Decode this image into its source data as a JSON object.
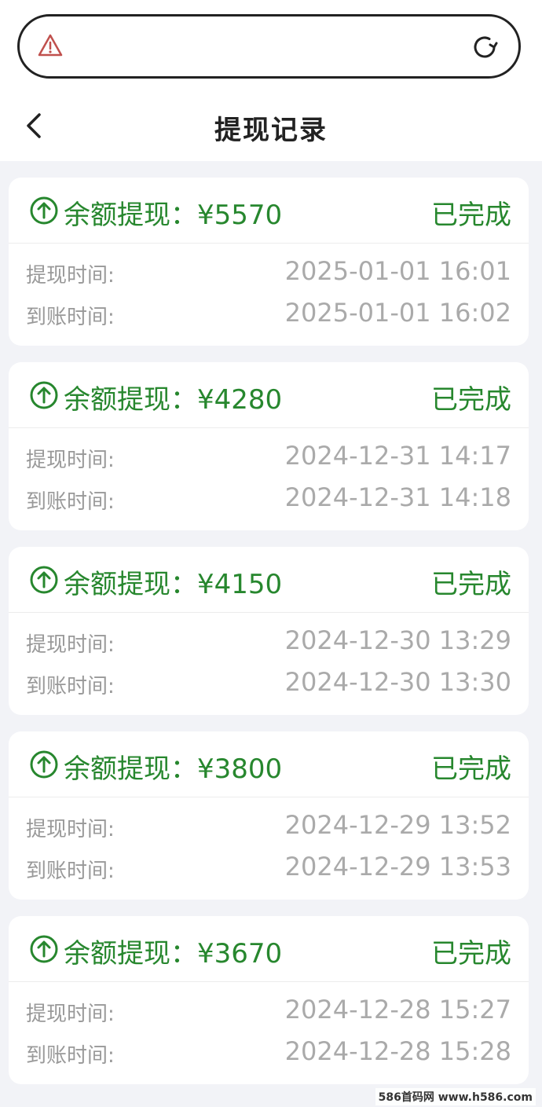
{
  "browser": {
    "warning_icon": "warning-triangle-icon",
    "reload_icon": "reload-icon"
  },
  "header": {
    "back_icon": "chevron-left-icon",
    "title": "提现记录"
  },
  "colors": {
    "accent_green": "#27872e",
    "muted_text": "#aaaaaa",
    "page_background": "#f2f3f7"
  },
  "records": [
    {
      "title": "余额提现：¥5570",
      "status": "已完成",
      "withdraw_label": "提现时间:",
      "withdraw_time": "2025-01-01 16:01",
      "arrival_label": "到账时间:",
      "arrival_time": "2025-01-01 16:02"
    },
    {
      "title": "余额提现：¥4280",
      "status": "已完成",
      "withdraw_label": "提现时间:",
      "withdraw_time": "2024-12-31 14:17",
      "arrival_label": "到账时间:",
      "arrival_time": "2024-12-31 14:18"
    },
    {
      "title": "余额提现：¥4150",
      "status": "已完成",
      "withdraw_label": "提现时间:",
      "withdraw_time": "2024-12-30 13:29",
      "arrival_label": "到账时间:",
      "arrival_time": "2024-12-30 13:30"
    },
    {
      "title": "余额提现：¥3800",
      "status": "已完成",
      "withdraw_label": "提现时间:",
      "withdraw_time": "2024-12-29 13:52",
      "arrival_label": "到账时间:",
      "arrival_time": "2024-12-29 13:53"
    },
    {
      "title": "余额提现：¥3670",
      "status": "已完成",
      "withdraw_label": "提现时间:",
      "withdraw_time": "2024-12-28 15:27",
      "arrival_label": "到账时间:",
      "arrival_time": "2024-12-28 15:28"
    }
  ],
  "watermark": "586首码网 www.h586.com"
}
